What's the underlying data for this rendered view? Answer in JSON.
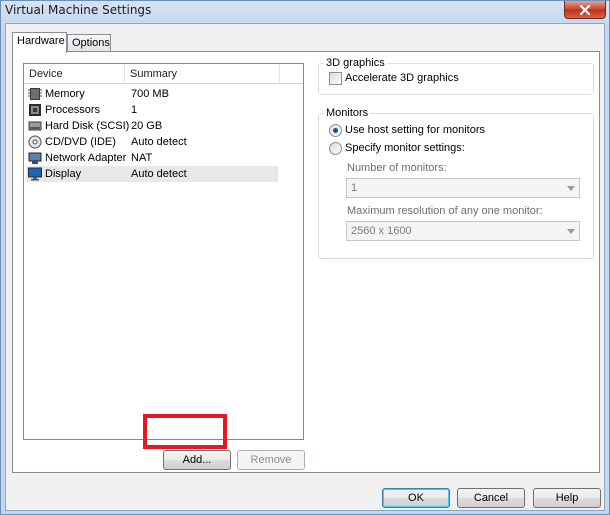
{
  "window": {
    "title": "Virtual Machine Settings"
  },
  "tabs": [
    {
      "label": "Hardware",
      "active": true
    },
    {
      "label": "Options",
      "active": false
    }
  ],
  "device_list": {
    "columns": [
      "Device",
      "Summary"
    ],
    "rows": [
      {
        "device": "Memory",
        "summary": "700 MB",
        "icon": "memory-icon"
      },
      {
        "device": "Processors",
        "summary": "1",
        "icon": "processor-icon"
      },
      {
        "device": "Hard Disk (SCSI)",
        "summary": "20 GB",
        "icon": "hard-disk-icon"
      },
      {
        "device": "CD/DVD (IDE)",
        "summary": "Auto detect",
        "icon": "cd-dvd-icon"
      },
      {
        "device": "Network Adapter",
        "summary": "NAT",
        "icon": "network-adapter-icon"
      },
      {
        "device": "Display",
        "summary": "Auto detect",
        "icon": "display-icon",
        "selected": true
      }
    ]
  },
  "buttons": {
    "add": "Add...",
    "remove": "Remove",
    "ok": "OK",
    "cancel": "Cancel",
    "help": "Help"
  },
  "graphics": {
    "group_label": "3D graphics",
    "accelerate_label": "Accelerate 3D graphics",
    "accelerate_checked": false
  },
  "monitors": {
    "group_label": "Monitors",
    "use_host_label": "Use host setting for monitors",
    "specify_label": "Specify monitor settings:",
    "selected_option": "use_host",
    "count_label": "Number of monitors:",
    "count_value": "1",
    "max_res_label": "Maximum resolution of any one monitor:",
    "max_res_value": "2560 x 1600"
  },
  "colors": {
    "highlight": "#e41a22",
    "selected_row": "#e8e8e8",
    "close_button": "#c7432e"
  }
}
